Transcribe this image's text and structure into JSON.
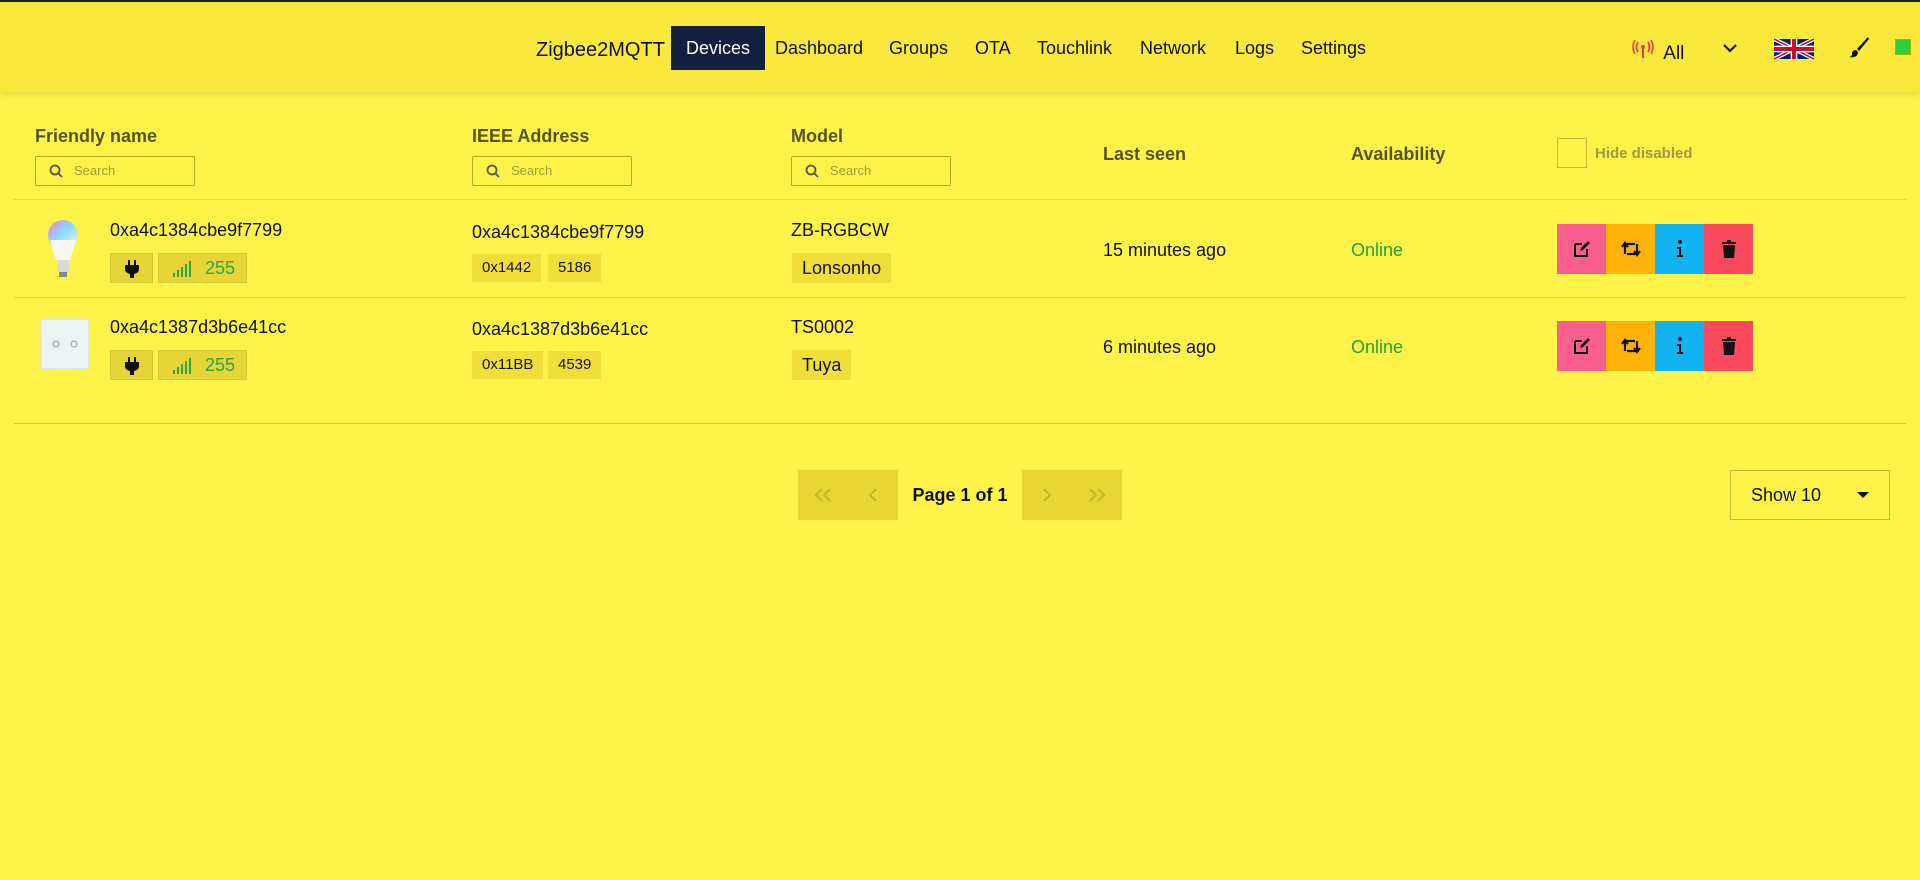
{
  "nav": {
    "brand": "Zigbee2MQTT",
    "items": [
      "Devices",
      "Dashboard",
      "Groups",
      "OTA",
      "Touchlink",
      "Network",
      "Logs",
      "Settings"
    ],
    "active": "Devices",
    "permit_join_label": "All",
    "permit_icon": "antenna-icon",
    "language_flag": "uk-flag-icon",
    "theme_icon": "brush-icon"
  },
  "table": {
    "headers": {
      "friendly_name": "Friendly name",
      "ieee": "IEEE Address",
      "model": "Model",
      "last_seen": "Last seen",
      "availability": "Availability",
      "hide_disabled": "Hide disabled"
    },
    "search_placeholder": "Search",
    "rows": [
      {
        "friendly_name": "0xa4c1384cbe9f7799",
        "thumb": "bulb-image",
        "power_icon": "plug-icon",
        "lqi": "255",
        "ieee": "0xa4c1384cbe9f7799",
        "nwk": "0x1442",
        "nwk_dec": "5186",
        "model": "ZB-RGBCW",
        "vendor": "Lonsonho",
        "last_seen": "15 minutes ago",
        "availability": "Online"
      },
      {
        "friendly_name": "0xa4c1387d3b6e41cc",
        "thumb": "wall-switch-image",
        "power_icon": "plug-icon",
        "lqi": "255",
        "ieee": "0xa4c1387d3b6e41cc",
        "nwk": "0x11BB",
        "nwk_dec": "4539",
        "model": "TS0002",
        "vendor": "Tuya",
        "last_seen": "6 minutes ago",
        "availability": "Online"
      }
    ]
  },
  "pagination": {
    "label": "Page 1 of 1",
    "page_size_label": "Show 10"
  },
  "colors": {
    "background": "#fff34a",
    "navbar": "#fbe83d",
    "active_nav": "#14203f",
    "online": "#1ea43a",
    "edit": "#f85f8f",
    "rename": "#fdb30a",
    "info": "#11b3f0",
    "delete": "#f9495c"
  }
}
